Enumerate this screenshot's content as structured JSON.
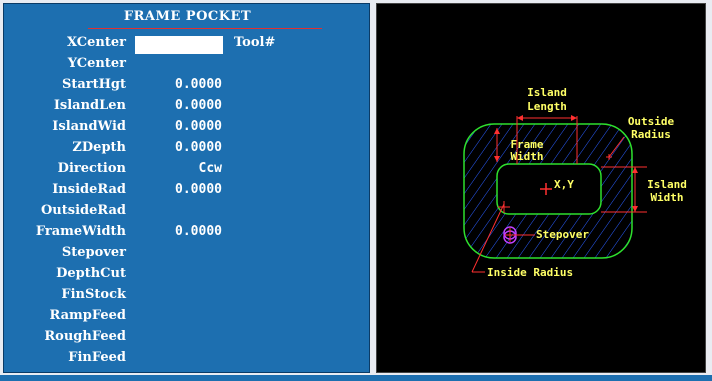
{
  "form": {
    "title": "FRAME POCKET",
    "tool_label": "Tool#",
    "fields": [
      {
        "label": "XCenter",
        "value": ""
      },
      {
        "label": "YCenter",
        "value": ""
      },
      {
        "label": "StartHgt",
        "value": "0.0000"
      },
      {
        "label": "IslandLen",
        "value": "0.0000"
      },
      {
        "label": "IslandWid",
        "value": "0.0000"
      },
      {
        "label": "ZDepth",
        "value": "0.0000"
      },
      {
        "label": "Direction",
        "value": "Ccw"
      },
      {
        "label": "InsideRad",
        "value": "0.0000"
      },
      {
        "label": "OutsideRad",
        "value": ""
      },
      {
        "label": "FrameWidth",
        "value": "0.0000"
      },
      {
        "label": "Stepover",
        "value": ""
      },
      {
        "label": "DepthCut",
        "value": ""
      },
      {
        "label": "FinStock",
        "value": ""
      },
      {
        "label": "RampFeed",
        "value": ""
      },
      {
        "label": "RoughFeed",
        "value": ""
      },
      {
        "label": "FinFeed",
        "value": ""
      }
    ]
  },
  "diagram": {
    "island_length_1": "Island",
    "island_length_2": "Length",
    "outside_radius_1": "Outside",
    "outside_radius_2": "Radius",
    "frame_width_1": "Frame",
    "frame_width_2": "Width",
    "center": "X,Y",
    "island_width_1": "Island",
    "island_width_2": "Width",
    "stepover": "Stepover",
    "inside_radius": "Inside Radius"
  },
  "colors": {
    "panel": "#1d6fb0",
    "diagram_bg": "#000000",
    "outline": "#2ee02e",
    "label": "#ffff66",
    "marker": "#ff3030",
    "tool": "#c040ff"
  }
}
